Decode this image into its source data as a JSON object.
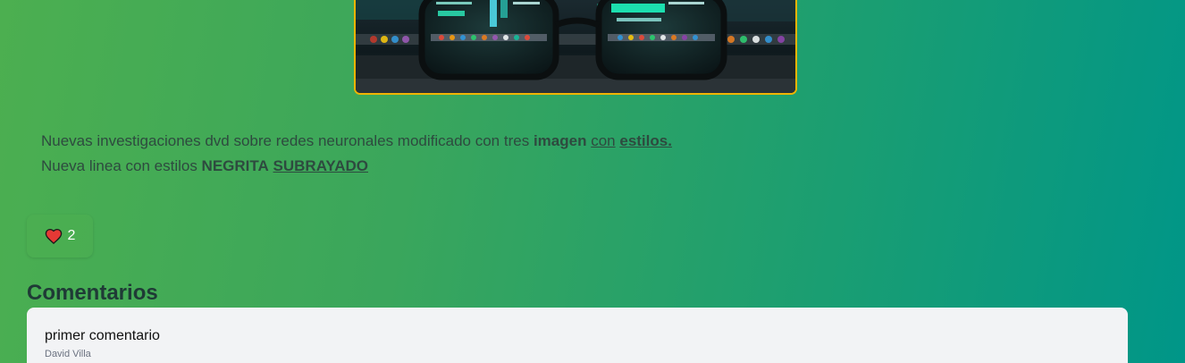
{
  "post": {
    "image_alt": "Glasses in front of computer monitors",
    "description": {
      "line1_text": "Nuevas investigaciones dvd sobre redes neuronales modificado con tres ",
      "line1_bold": "imagen",
      "line1_space": " ",
      "line1_underline": "con",
      "line1_space2": " ",
      "line1_bold_underline": "estilos.",
      "line2_text": "Nueva linea con estilos ",
      "line2_bold": "NEGRITA",
      "line2_space": " ",
      "line2_bold_underline": "SUBRAYADO"
    },
    "likes": {
      "icon": "heart-icon",
      "count": "2"
    }
  },
  "comments": {
    "title": "Comentarios",
    "items": [
      {
        "text": "primer comentario",
        "author": "David Villa"
      }
    ]
  },
  "colors": {
    "background_start": "#4caf50",
    "background_end": "#009688",
    "image_border": "#f0b400",
    "heart": "#e53935",
    "card": "#f2f3f5"
  }
}
